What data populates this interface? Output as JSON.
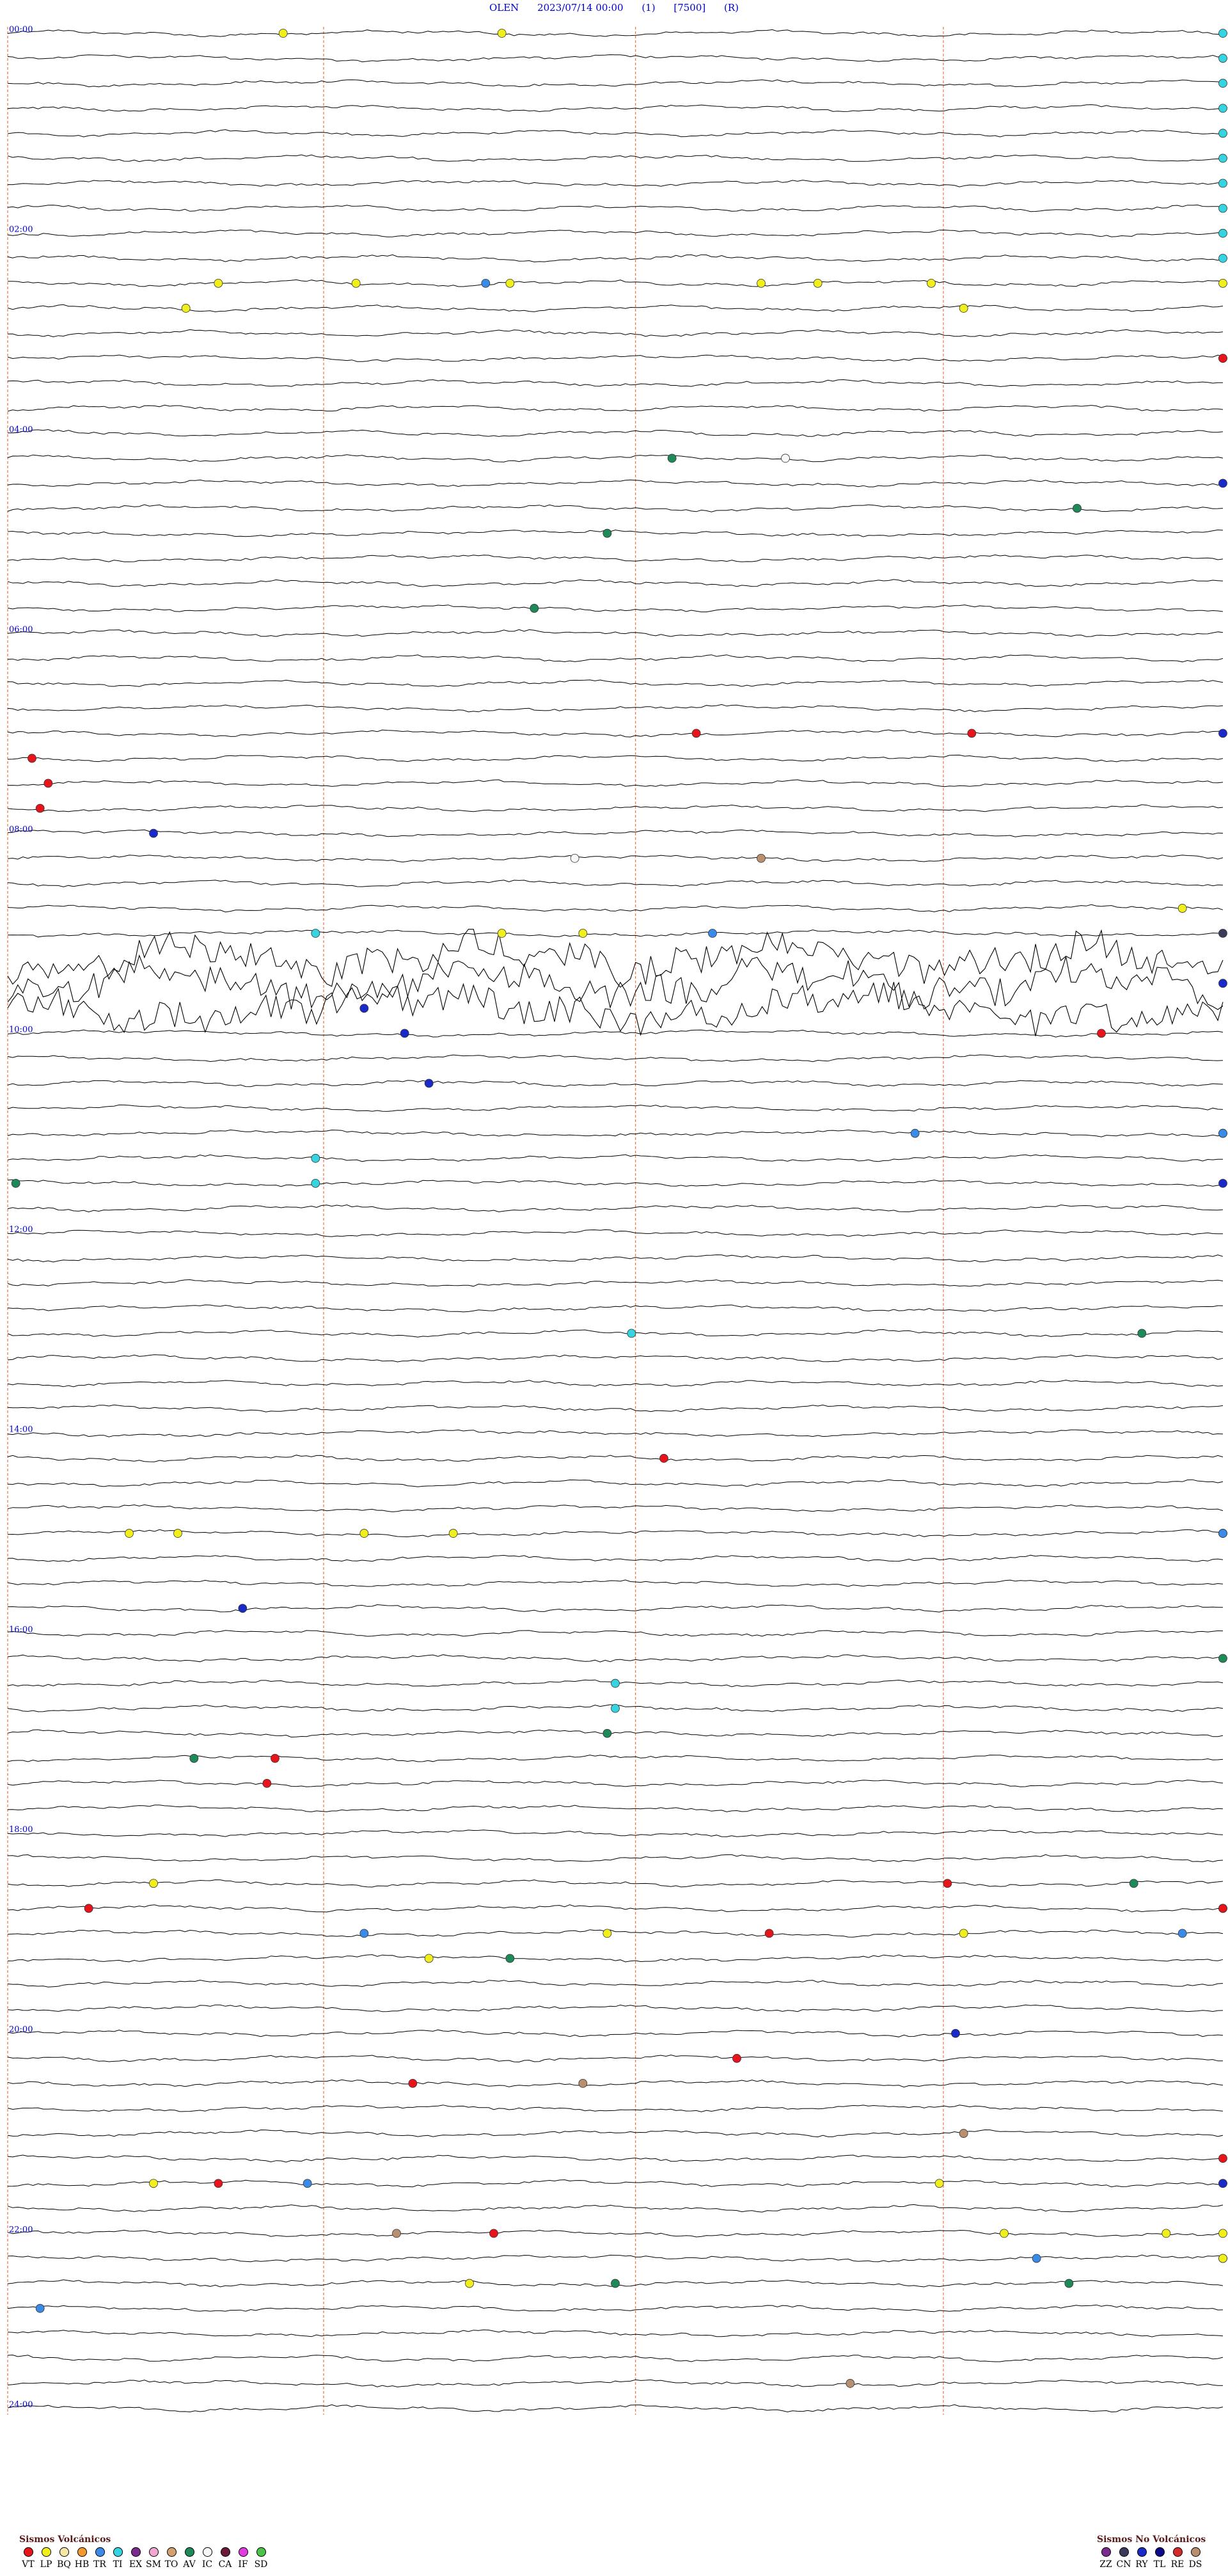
{
  "header": {
    "station": "OLEN",
    "datetime": "2023/07/14 00:00",
    "channel": "(1)",
    "scale": "[7500]",
    "flag": "(R)"
  },
  "chart_data": {
    "type": "line",
    "description_rows": "helicorder: 96 traces of 15 minutes each, hour markers every 4 traces",
    "x": {
      "unit": "minute of trace",
      "range": [
        0,
        15
      ],
      "marker_minutes": [
        0,
        3.9,
        7.75,
        11.55
      ]
    },
    "time_labels": [
      "00:00",
      "02:00",
      "04:00",
      "06:00",
      "08:00",
      "10:00",
      "12:00",
      "14:00",
      "16:00",
      "18:00",
      "20:00",
      "22:00",
      "24:00"
    ],
    "rows": 96,
    "events": [
      {
        "row": 0,
        "minute": 3.4,
        "type": "LP"
      },
      {
        "row": 0,
        "minute": 6.1,
        "type": "LP"
      },
      {
        "row": 0,
        "minute": 15.3,
        "type": "TI"
      },
      {
        "row": 1,
        "minute": 15.3,
        "type": "TI"
      },
      {
        "row": 2,
        "minute": 15.3,
        "type": "TI"
      },
      {
        "row": 3,
        "minute": 15.3,
        "type": "TI"
      },
      {
        "row": 4,
        "minute": 15.3,
        "type": "TI"
      },
      {
        "row": 5,
        "minute": 15.3,
        "type": "TI"
      },
      {
        "row": 6,
        "minute": 15.3,
        "type": "TI"
      },
      {
        "row": 7,
        "minute": 15.3,
        "type": "TI"
      },
      {
        "row": 8,
        "minute": 15.3,
        "type": "TI"
      },
      {
        "row": 9,
        "minute": 15.3,
        "type": "TI"
      },
      {
        "row": 10,
        "minute": 2.6,
        "type": "LP"
      },
      {
        "row": 10,
        "minute": 4.3,
        "type": "LP"
      },
      {
        "row": 10,
        "minute": 6.2,
        "type": "LP"
      },
      {
        "row": 10,
        "minute": 5.9,
        "type": "TR"
      },
      {
        "row": 10,
        "minute": 9.3,
        "type": "LP"
      },
      {
        "row": 10,
        "minute": 10.0,
        "type": "LP"
      },
      {
        "row": 10,
        "minute": 11.4,
        "type": "LP"
      },
      {
        "row": 10,
        "minute": 16.2,
        "type": "LP"
      },
      {
        "row": 11,
        "minute": 2.2,
        "type": "LP"
      },
      {
        "row": 11,
        "minute": 11.8,
        "type": "LP"
      },
      {
        "row": 13,
        "minute": 16.0,
        "type": "LP"
      },
      {
        "row": 13,
        "minute": 17.3,
        "type": "VT"
      },
      {
        "row": 17,
        "minute": 8.2,
        "type": "AV"
      },
      {
        "row": 17,
        "minute": 9.6,
        "type": "IC"
      },
      {
        "row": 18,
        "minute": 16.0,
        "type": "RY"
      },
      {
        "row": 19,
        "minute": 13.2,
        "type": "AV"
      },
      {
        "row": 20,
        "minute": 7.4,
        "type": "AV"
      },
      {
        "row": 23,
        "minute": 6.5,
        "type": "AV"
      },
      {
        "row": 28,
        "minute": 8.5,
        "type": "VT"
      },
      {
        "row": 28,
        "minute": 11.9,
        "type": "VT"
      },
      {
        "row": 28,
        "minute": 17.6,
        "type": "RY"
      },
      {
        "row": 29,
        "minute": 0.3,
        "type": "VT"
      },
      {
        "row": 30,
        "minute": 0.5,
        "type": "VT"
      },
      {
        "row": 31,
        "minute": 0.4,
        "type": "VT"
      },
      {
        "row": 32,
        "minute": 1.8,
        "type": "RY"
      },
      {
        "row": 33,
        "minute": 7.0,
        "type": "IC"
      },
      {
        "row": 33,
        "minute": 9.3,
        "type": "DS"
      },
      {
        "row": 35,
        "minute": 14.5,
        "type": "LP"
      },
      {
        "row": 36,
        "minute": 3.8,
        "type": "TI"
      },
      {
        "row": 36,
        "minute": 6.1,
        "type": "LP"
      },
      {
        "row": 36,
        "minute": 7.1,
        "type": "LP"
      },
      {
        "row": 36,
        "minute": 8.7,
        "type": "TR"
      },
      {
        "row": 36,
        "minute": 18.1,
        "type": "CN"
      },
      {
        "row": 38,
        "minute": 15.1,
        "type": "RY"
      },
      {
        "row": 39,
        "minute": 4.4,
        "type": "RY"
      },
      {
        "row": 40,
        "minute": 13.5,
        "type": "VT"
      },
      {
        "row": 40,
        "minute": 4.9,
        "type": "RY"
      },
      {
        "row": 42,
        "minute": 5.2,
        "type": "RY"
      },
      {
        "row": 44,
        "minute": 17.6,
        "type": "LP"
      },
      {
        "row": 44,
        "minute": 11.2,
        "type": "TR"
      },
      {
        "row": 44,
        "minute": 19.0,
        "type": "TR"
      },
      {
        "row": 45,
        "minute": 3.8,
        "type": "TI"
      },
      {
        "row": 46,
        "minute": 3.8,
        "type": "TI"
      },
      {
        "row": 46,
        "minute": 0.1,
        "type": "AV"
      },
      {
        "row": 46,
        "minute": 15.3,
        "type": "RY"
      },
      {
        "row": 52,
        "minute": 7.7,
        "type": "TI"
      },
      {
        "row": 52,
        "minute": 14.0,
        "type": "AV"
      },
      {
        "row": 57,
        "minute": 8.1,
        "type": "VT"
      },
      {
        "row": 60,
        "minute": 1.5,
        "type": "LP"
      },
      {
        "row": 60,
        "minute": 2.1,
        "type": "LP"
      },
      {
        "row": 60,
        "minute": 4.4,
        "type": "LP"
      },
      {
        "row": 60,
        "minute": 5.5,
        "type": "LP"
      },
      {
        "row": 60,
        "minute": 15.3,
        "type": "LP"
      },
      {
        "row": 60,
        "minute": 15.6,
        "type": "LP"
      },
      {
        "row": 60,
        "minute": 17.3,
        "type": "TR"
      },
      {
        "row": 63,
        "minute": 2.9,
        "type": "RY"
      },
      {
        "row": 65,
        "minute": 15.8,
        "type": "AV"
      },
      {
        "row": 66,
        "minute": 7.5,
        "type": "TI"
      },
      {
        "row": 67,
        "minute": 7.5,
        "type": "TI"
      },
      {
        "row": 68,
        "minute": 7.4,
        "type": "AV"
      },
      {
        "row": 69,
        "minute": 3.3,
        "type": "VT"
      },
      {
        "row": 69,
        "minute": 2.3,
        "type": "AV"
      },
      {
        "row": 70,
        "minute": 3.2,
        "type": "VT"
      },
      {
        "row": 74,
        "minute": 1.8,
        "type": "LP"
      },
      {
        "row": 74,
        "minute": 13.9,
        "type": "AV"
      },
      {
        "row": 74,
        "minute": 11.6,
        "type": "VT"
      },
      {
        "row": 75,
        "minute": 1.0,
        "type": "VT"
      },
      {
        "row": 75,
        "minute": 15.5,
        "type": "VT"
      },
      {
        "row": 75,
        "minute": 15.9,
        "type": "VT"
      },
      {
        "row": 76,
        "minute": 4.4,
        "type": "TR"
      },
      {
        "row": 76,
        "minute": 7.4,
        "type": "LP"
      },
      {
        "row": 76,
        "minute": 9.4,
        "type": "VT"
      },
      {
        "row": 76,
        "minute": 11.8,
        "type": "LP"
      },
      {
        "row": 76,
        "minute": 14.5,
        "type": "TR"
      },
      {
        "row": 77,
        "minute": 5.2,
        "type": "LP"
      },
      {
        "row": 77,
        "minute": 6.2,
        "type": "AV"
      },
      {
        "row": 80,
        "minute": 11.7,
        "type": "RY"
      },
      {
        "row": 81,
        "minute": 9.0,
        "type": "VT"
      },
      {
        "row": 82,
        "minute": 5.0,
        "type": "VT"
      },
      {
        "row": 82,
        "minute": 7.1,
        "type": "DS"
      },
      {
        "row": 84,
        "minute": 11.8,
        "type": "DS"
      },
      {
        "row": 85,
        "minute": 18.2,
        "type": "VT"
      },
      {
        "row": 86,
        "minute": 1.8,
        "type": "LP"
      },
      {
        "row": 86,
        "minute": 2.6,
        "type": "VT"
      },
      {
        "row": 86,
        "minute": 3.7,
        "type": "TR"
      },
      {
        "row": 86,
        "minute": 11.5,
        "type": "LP"
      },
      {
        "row": 86,
        "minute": 17.4,
        "type": "RY"
      },
      {
        "row": 86,
        "minute": 18.1,
        "type": "RY"
      },
      {
        "row": 88,
        "minute": 4.8,
        "type": "DS"
      },
      {
        "row": 88,
        "minute": 6.0,
        "type": "VT"
      },
      {
        "row": 88,
        "minute": 12.3,
        "type": "LP"
      },
      {
        "row": 88,
        "minute": 14.3,
        "type": "LP"
      },
      {
        "row": 88,
        "minute": 15.5,
        "type": "LP"
      },
      {
        "row": 89,
        "minute": 12.7,
        "type": "TR"
      },
      {
        "row": 89,
        "minute": 15.8,
        "type": "LP"
      },
      {
        "row": 89,
        "minute": 17.9,
        "type": "LP"
      },
      {
        "row": 90,
        "minute": 5.7,
        "type": "LP"
      },
      {
        "row": 90,
        "minute": 7.5,
        "type": "AV"
      },
      {
        "row": 90,
        "minute": 13.1,
        "type": "AV"
      },
      {
        "row": 91,
        "minute": 0.4,
        "type": "TR"
      },
      {
        "row": 94,
        "minute": 10.4,
        "type": "DS"
      }
    ]
  },
  "legend_volcanic": {
    "title": "Sismos Volcánicos",
    "items": [
      {
        "code": "VT",
        "color": "#e8141c"
      },
      {
        "code": "LP",
        "color": "#f1ef1b"
      },
      {
        "code": "BQ",
        "color": "#f7e7a6"
      },
      {
        "code": "HB",
        "color": "#f29a2e"
      },
      {
        "code": "TR",
        "color": "#3a8be8"
      },
      {
        "code": "TI",
        "color": "#35d4e0"
      },
      {
        "code": "EX",
        "color": "#7b2a8e"
      },
      {
        "code": "SM",
        "color": "#f2a6d0"
      },
      {
        "code": "TO",
        "color": "#d4a070"
      },
      {
        "code": "AV",
        "color": "#1e8a5a"
      },
      {
        "code": "IC",
        "color": "#f7f7f7"
      },
      {
        "code": "CA",
        "color": "#6b1a3a"
      },
      {
        "code": "IF",
        "color": "#e03ce0"
      },
      {
        "code": "SD",
        "color": "#4cc44c"
      }
    ]
  },
  "legend_nonvolcanic": {
    "title": "Sismos No Volcánicos",
    "items": [
      {
        "code": "ZZ",
        "color": "#7b2a8e"
      },
      {
        "code": "CN",
        "color": "#3a3a5a"
      },
      {
        "code": "RY",
        "color": "#1a2ac8"
      },
      {
        "code": "TL",
        "color": "#0a0a8a"
      },
      {
        "code": "RE",
        "color": "#d42a2a"
      },
      {
        "code": "DS",
        "color": "#b89070"
      }
    ]
  },
  "colors": {
    "trace": "#000000",
    "marker_line": "#f07040",
    "label": "#0000cc"
  }
}
